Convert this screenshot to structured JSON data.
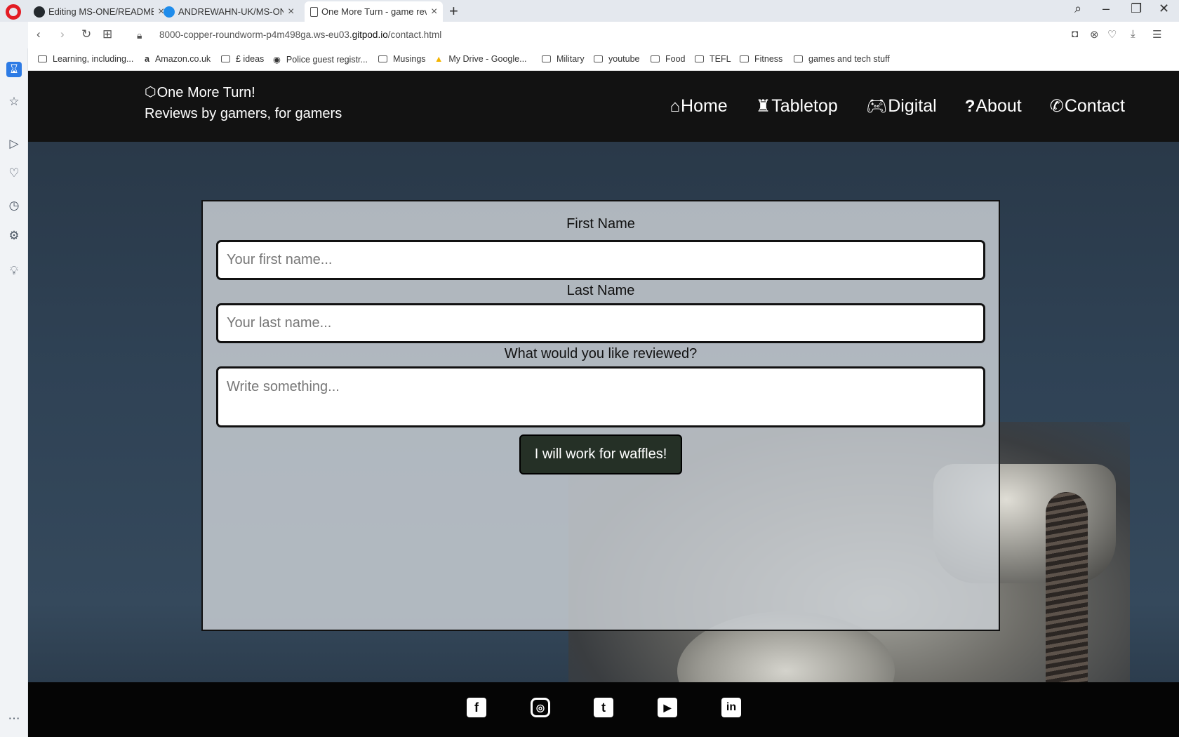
{
  "browser": {
    "tabs": [
      {
        "title": "Editing MS-ONE/README.md",
        "icon_color": "#24292e"
      },
      {
        "title": "ANDREWAHN-UK/MS-ONE",
        "icon_color": "#1f8ceb"
      },
      {
        "title": "One More Turn - game reviews",
        "icon_color": "#555555"
      }
    ],
    "url_prefix": "8000-copper-roundworm-p4m498ga.ws-eu03.",
    "url_domain": "gitpod.io",
    "url_path": "/contact.html",
    "bookmarks": [
      "Learning, including...",
      "Amazon.co.uk",
      "£ ideas",
      "Police guest registr...",
      "Musings",
      "My Drive - Google...",
      "Military",
      "youtube",
      "Food",
      "TEFL",
      "Fitness",
      "games and tech stuff"
    ]
  },
  "site": {
    "brand_title": "One More Turn!",
    "brand_tagline": "Reviews by gamers, for gamers",
    "nav": [
      "Home",
      "Tabletop",
      "Digital",
      "About",
      "Contact"
    ]
  },
  "form": {
    "first_name_label": "First Name",
    "first_name_placeholder": "Your first name...",
    "last_name_label": "Last Name",
    "last_name_placeholder": "Your last name...",
    "review_label": "What would you like reviewed?",
    "review_placeholder": "Write something...",
    "submit_label": "I will work for waffles!"
  },
  "footer": {
    "social": [
      "facebook-icon",
      "instagram-icon",
      "twitter-icon",
      "youtube-icon",
      "linkedin-icon"
    ]
  }
}
